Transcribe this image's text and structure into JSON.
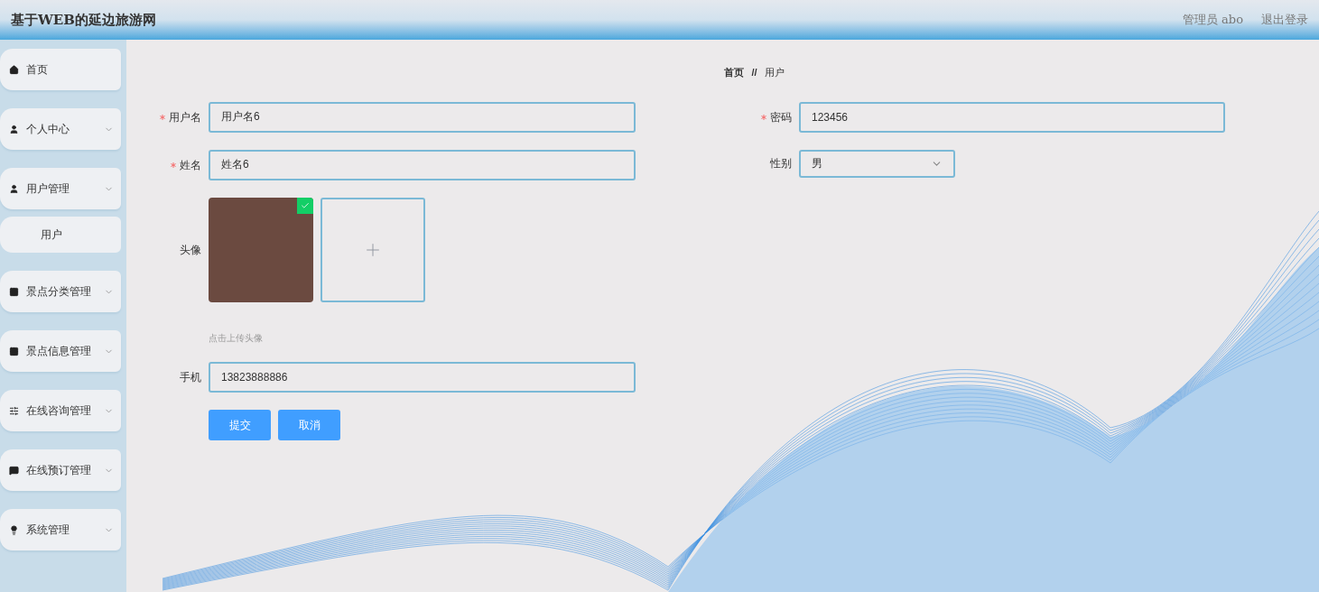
{
  "header": {
    "title": "基于WEB的延边旅游网",
    "user": "管理员 abo",
    "logout": "退出登录"
  },
  "sidebar": {
    "items": [
      {
        "label": "首页",
        "has_arrow": false
      },
      {
        "label": "个人中心",
        "has_arrow": true
      },
      {
        "label": "用户管理",
        "has_arrow": true,
        "children": [
          {
            "label": "用户"
          }
        ]
      },
      {
        "label": "景点分类管理",
        "has_arrow": true
      },
      {
        "label": "景点信息管理",
        "has_arrow": true
      },
      {
        "label": "在线咨询管理",
        "has_arrow": true
      },
      {
        "label": "在线预订管理",
        "has_arrow": true
      },
      {
        "label": "系统管理",
        "has_arrow": true
      }
    ]
  },
  "breadcrumb": {
    "home": "首页",
    "separator": "//",
    "current": "用户"
  },
  "form": {
    "left": [
      {
        "kind": "text",
        "label": "用户名",
        "required": true,
        "value": "用户名6"
      },
      {
        "kind": "text",
        "label": "姓名",
        "required": true,
        "value": "姓名6"
      },
      {
        "kind": "upload",
        "label": "头像",
        "required": false,
        "uploaded": true,
        "hint": "点击上传头像"
      },
      {
        "kind": "text",
        "label": "手机",
        "required": false,
        "value": "13823888886"
      }
    ],
    "right": [
      {
        "kind": "text",
        "label": "密码",
        "required": true,
        "value": "123456"
      },
      {
        "kind": "select",
        "label": "性别",
        "required": false,
        "value": "男"
      }
    ],
    "buttons": [
      "提交",
      "取消"
    ]
  }
}
